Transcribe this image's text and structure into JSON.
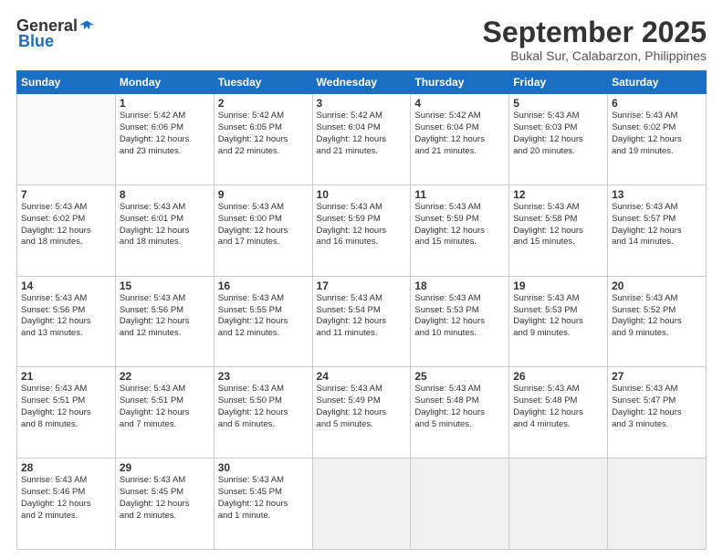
{
  "logo": {
    "general": "General",
    "blue": "Blue"
  },
  "title": "September 2025",
  "subtitle": "Bukal Sur, Calabarzon, Philippines",
  "days_of_week": [
    "Sunday",
    "Monday",
    "Tuesday",
    "Wednesday",
    "Thursday",
    "Friday",
    "Saturday"
  ],
  "weeks": [
    [
      {
        "day": "",
        "detail": ""
      },
      {
        "day": "1",
        "detail": "Sunrise: 5:42 AM\nSunset: 6:06 PM\nDaylight: 12 hours\nand 23 minutes."
      },
      {
        "day": "2",
        "detail": "Sunrise: 5:42 AM\nSunset: 6:05 PM\nDaylight: 12 hours\nand 22 minutes."
      },
      {
        "day": "3",
        "detail": "Sunrise: 5:42 AM\nSunset: 6:04 PM\nDaylight: 12 hours\nand 21 minutes."
      },
      {
        "day": "4",
        "detail": "Sunrise: 5:42 AM\nSunset: 6:04 PM\nDaylight: 12 hours\nand 21 minutes."
      },
      {
        "day": "5",
        "detail": "Sunrise: 5:43 AM\nSunset: 6:03 PM\nDaylight: 12 hours\nand 20 minutes."
      },
      {
        "day": "6",
        "detail": "Sunrise: 5:43 AM\nSunset: 6:02 PM\nDaylight: 12 hours\nand 19 minutes."
      }
    ],
    [
      {
        "day": "7",
        "detail": "Sunrise: 5:43 AM\nSunset: 6:02 PM\nDaylight: 12 hours\nand 18 minutes."
      },
      {
        "day": "8",
        "detail": "Sunrise: 5:43 AM\nSunset: 6:01 PM\nDaylight: 12 hours\nand 18 minutes."
      },
      {
        "day": "9",
        "detail": "Sunrise: 5:43 AM\nSunset: 6:00 PM\nDaylight: 12 hours\nand 17 minutes."
      },
      {
        "day": "10",
        "detail": "Sunrise: 5:43 AM\nSunset: 5:59 PM\nDaylight: 12 hours\nand 16 minutes."
      },
      {
        "day": "11",
        "detail": "Sunrise: 5:43 AM\nSunset: 5:59 PM\nDaylight: 12 hours\nand 15 minutes."
      },
      {
        "day": "12",
        "detail": "Sunrise: 5:43 AM\nSunset: 5:58 PM\nDaylight: 12 hours\nand 15 minutes."
      },
      {
        "day": "13",
        "detail": "Sunrise: 5:43 AM\nSunset: 5:57 PM\nDaylight: 12 hours\nand 14 minutes."
      }
    ],
    [
      {
        "day": "14",
        "detail": "Sunrise: 5:43 AM\nSunset: 5:56 PM\nDaylight: 12 hours\nand 13 minutes."
      },
      {
        "day": "15",
        "detail": "Sunrise: 5:43 AM\nSunset: 5:56 PM\nDaylight: 12 hours\nand 12 minutes."
      },
      {
        "day": "16",
        "detail": "Sunrise: 5:43 AM\nSunset: 5:55 PM\nDaylight: 12 hours\nand 12 minutes."
      },
      {
        "day": "17",
        "detail": "Sunrise: 5:43 AM\nSunset: 5:54 PM\nDaylight: 12 hours\nand 11 minutes."
      },
      {
        "day": "18",
        "detail": "Sunrise: 5:43 AM\nSunset: 5:53 PM\nDaylight: 12 hours\nand 10 minutes."
      },
      {
        "day": "19",
        "detail": "Sunrise: 5:43 AM\nSunset: 5:53 PM\nDaylight: 12 hours\nand 9 minutes."
      },
      {
        "day": "20",
        "detail": "Sunrise: 5:43 AM\nSunset: 5:52 PM\nDaylight: 12 hours\nand 9 minutes."
      }
    ],
    [
      {
        "day": "21",
        "detail": "Sunrise: 5:43 AM\nSunset: 5:51 PM\nDaylight: 12 hours\nand 8 minutes."
      },
      {
        "day": "22",
        "detail": "Sunrise: 5:43 AM\nSunset: 5:51 PM\nDaylight: 12 hours\nand 7 minutes."
      },
      {
        "day": "23",
        "detail": "Sunrise: 5:43 AM\nSunset: 5:50 PM\nDaylight: 12 hours\nand 6 minutes."
      },
      {
        "day": "24",
        "detail": "Sunrise: 5:43 AM\nSunset: 5:49 PM\nDaylight: 12 hours\nand 5 minutes."
      },
      {
        "day": "25",
        "detail": "Sunrise: 5:43 AM\nSunset: 5:48 PM\nDaylight: 12 hours\nand 5 minutes."
      },
      {
        "day": "26",
        "detail": "Sunrise: 5:43 AM\nSunset: 5:48 PM\nDaylight: 12 hours\nand 4 minutes."
      },
      {
        "day": "27",
        "detail": "Sunrise: 5:43 AM\nSunset: 5:47 PM\nDaylight: 12 hours\nand 3 minutes."
      }
    ],
    [
      {
        "day": "28",
        "detail": "Sunrise: 5:43 AM\nSunset: 5:46 PM\nDaylight: 12 hours\nand 2 minutes."
      },
      {
        "day": "29",
        "detail": "Sunrise: 5:43 AM\nSunset: 5:45 PM\nDaylight: 12 hours\nand 2 minutes."
      },
      {
        "day": "30",
        "detail": "Sunrise: 5:43 AM\nSunset: 5:45 PM\nDaylight: 12 hours\nand 1 minute."
      },
      {
        "day": "",
        "detail": ""
      },
      {
        "day": "",
        "detail": ""
      },
      {
        "day": "",
        "detail": ""
      },
      {
        "day": "",
        "detail": ""
      }
    ]
  ]
}
